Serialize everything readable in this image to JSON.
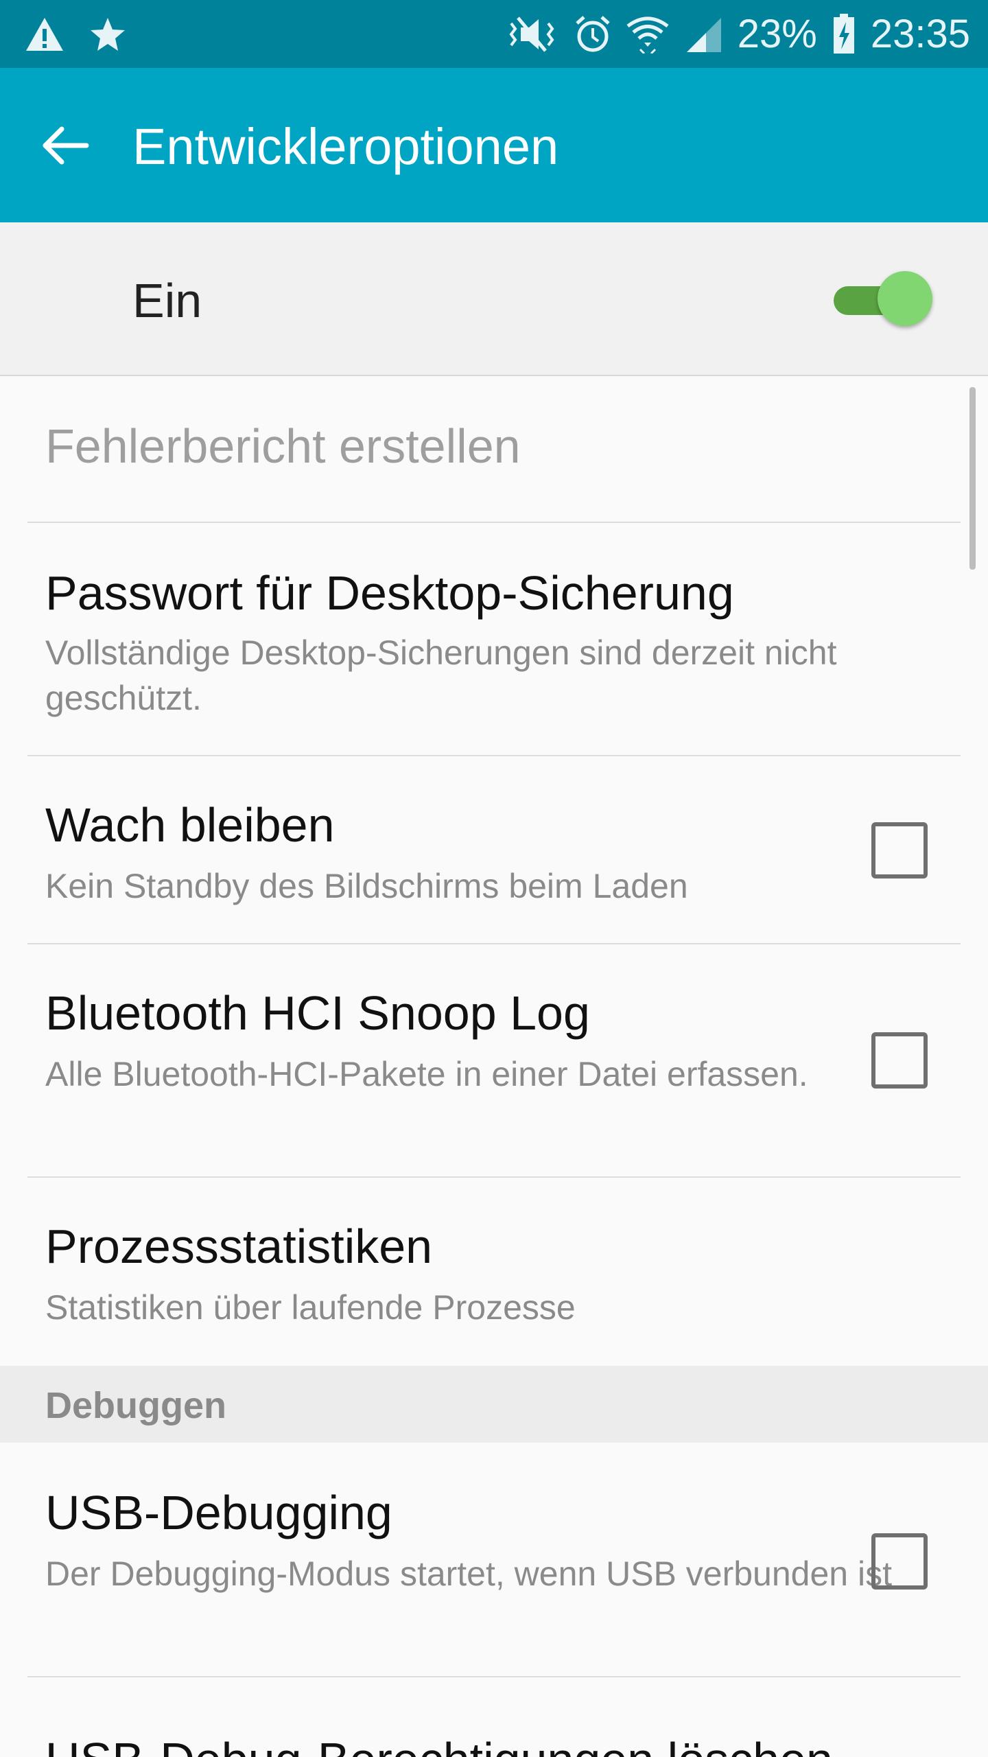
{
  "status_bar": {
    "battery_percent": "23%",
    "time": "23:35",
    "icons_left": [
      "warning-icon",
      "star-icon"
    ],
    "icons_right": [
      "mute-vibrate-icon",
      "alarm-icon",
      "wifi-icon",
      "signal-icon",
      "battery-charging-icon"
    ]
  },
  "app_bar": {
    "title": "Entwickleroptionen",
    "back_icon": "arrow-left-icon"
  },
  "master_switch": {
    "label": "Ein",
    "state": "on"
  },
  "items": [
    {
      "title": "Fehlerbericht erstellen",
      "enabled": false
    },
    {
      "title": "Passwort für Desktop-Sicherung",
      "subtitle": "Vollständige Desktop-Sicherungen sind derzeit nicht geschützt."
    },
    {
      "title": "Wach bleiben",
      "subtitle": "Kein Standby des Bildschirms beim Laden",
      "checked": false
    },
    {
      "title": "Bluetooth HCI Snoop Log",
      "subtitle": "Alle Bluetooth-HCI-Pakete in einer Datei erfassen.",
      "checked": false
    },
    {
      "title": "Prozessstatistiken",
      "subtitle": "Statistiken über laufende Prozesse"
    },
    {
      "title": "USB-Debugging",
      "subtitle": "Der Debugging-Modus startet, wenn USB verbunden ist",
      "checked": false
    },
    {
      "title": "USB-Debug-Berechtigungen löschen"
    }
  ],
  "sections": {
    "debugging_header": "Debuggen"
  },
  "colors": {
    "status_bar": "#00829a",
    "app_bar": "#00a5c4",
    "toggle_track": "#5aa342",
    "toggle_thumb": "#82d672"
  }
}
